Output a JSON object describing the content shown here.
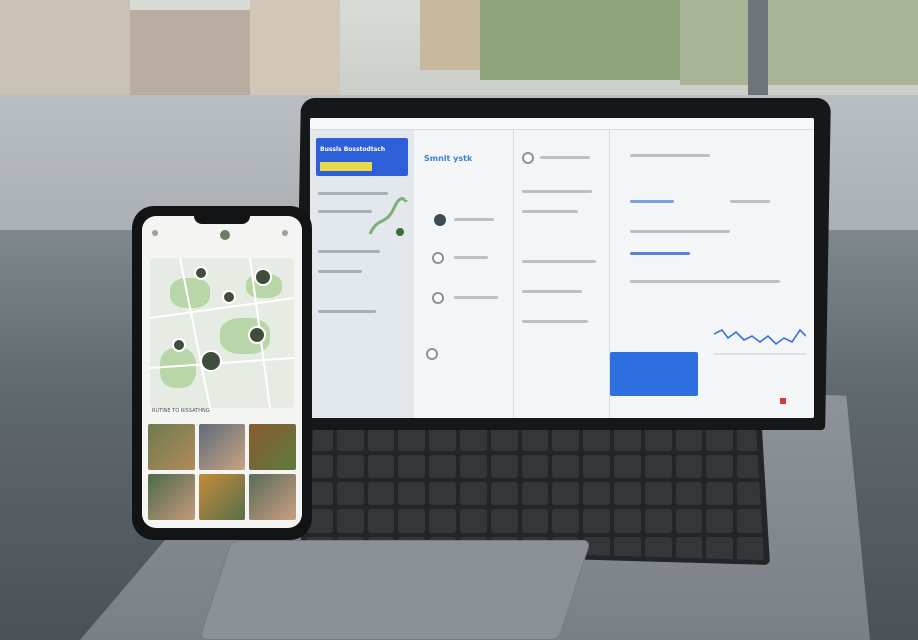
{
  "scene": {
    "description_tags": [
      "laptop",
      "smartphone",
      "outdoor-street-background"
    ],
    "colors": {
      "accent_blue": "#2e6fe0",
      "sidebar_header_blue": "#2e5fd6",
      "highlight_yellow": "#e9d84a",
      "map_green": "#b9d6a8",
      "chart_blue": "#3a6fd8"
    }
  },
  "laptop": {
    "sidebar_title": "Bussls Bosstodtsch",
    "main_heading": "Smnlt ystk"
  },
  "phone": {
    "caption": "RUTINE TO RISSATHNG"
  }
}
